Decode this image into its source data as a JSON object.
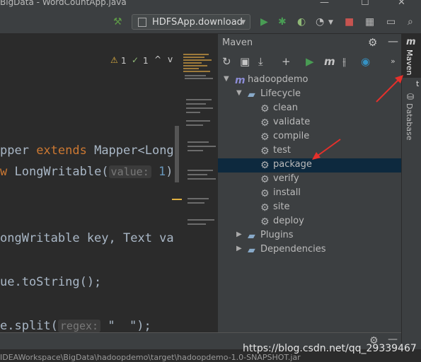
{
  "window": {
    "title": "BigData - WordCountApp.java"
  },
  "toolbar": {
    "run_config": "HDFSApp.download"
  },
  "editor": {
    "inspections": {
      "warnings": "1",
      "weak_warnings": "1"
    },
    "lines": [
      {
        "pre": "pper ",
        "kw": "extends",
        "post": " Mapper<Long"
      },
      {
        "kw": "w",
        "mid": " LongWritable(",
        "hint": "value:",
        "num": " 1",
        "post": ")"
      },
      {
        "text": "ongWritable key, Text va"
      },
      {
        "text": "ue.toString();"
      },
      {
        "pre": "e.split(",
        "hint": "regex:",
        "post": " \"  \");"
      }
    ]
  },
  "maven": {
    "title": "Maven",
    "tree": {
      "project": "hadoopdemo",
      "lifecycle": "Lifecycle",
      "goals": [
        "clean",
        "validate",
        "compile",
        "test",
        "package",
        "verify",
        "install",
        "site",
        "deploy"
      ],
      "plugins": "Plugins",
      "dependencies": "Dependencies"
    }
  },
  "sidebar": {
    "maven_tab": "Maven",
    "database_tab": "Database"
  },
  "statusbar": {
    "path_text": "IDEAWorkspace\\BigData\\hadoopdemo\\target\\hadoopdemo-1.0-SNAPSHOT.jar"
  },
  "watermark": "https://blog.csdn.net/qq_29339467",
  "colors": {
    "selection": "#0d293e",
    "accent_red": "#e5302b",
    "run_green": "#499c54"
  }
}
